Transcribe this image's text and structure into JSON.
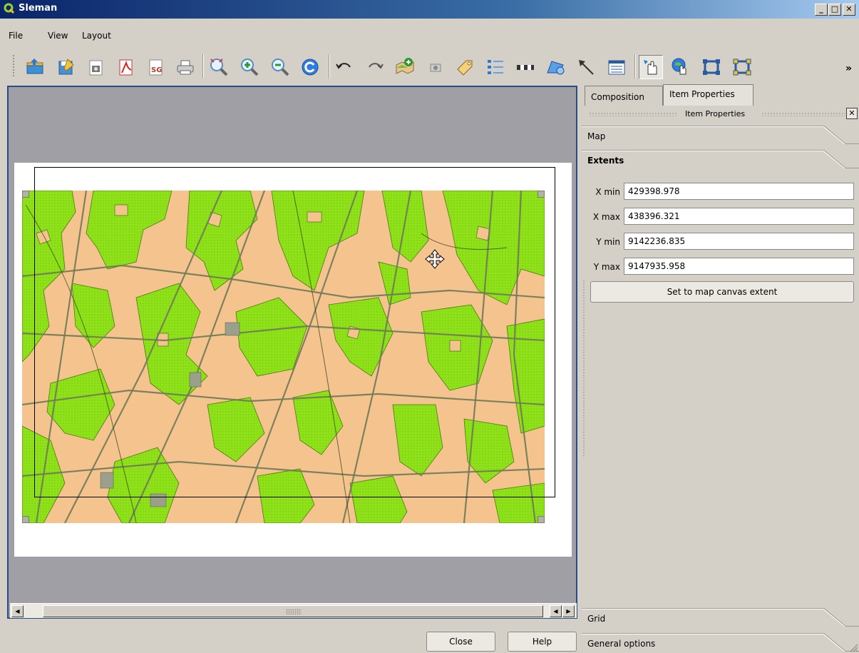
{
  "window": {
    "title": "Sleman"
  },
  "menu": {
    "items": [
      "File",
      "View",
      "Layout"
    ]
  },
  "toolbar": {
    "tools": [
      "load-from-template",
      "save-as-template",
      "export-image",
      "export-pdf",
      "export-svg",
      "print",
      "zoom-full",
      "zoom-in",
      "zoom-out",
      "refresh",
      "undo",
      "redo",
      "add-map",
      "add-image",
      "add-label",
      "add-legend",
      "add-scalebar",
      "add-shape",
      "add-arrow",
      "add-table",
      "select-move-item",
      "move-item-content",
      "group-items",
      "ungroup-items"
    ],
    "more": "»"
  },
  "panel": {
    "tabs": [
      "Composition",
      "Item Properties"
    ],
    "active_tab": "Item Properties",
    "dock_title": "Item Properties",
    "sections": {
      "map": "Map",
      "extents": "Extents",
      "grid": "Grid",
      "general": "General options"
    },
    "extents": {
      "xmin_label": "X min",
      "xmin": "429398.978",
      "xmax_label": "X max",
      "xmax": "438396.321",
      "ymin_label": "Y min",
      "ymin": "9142236.835",
      "ymax_label": "Y max",
      "ymax": "9147935.958"
    },
    "set_extent_button": "Set to map canvas extent"
  },
  "footer": {
    "close": "Close",
    "help": "Help"
  },
  "colors": {
    "land": "#f5c48e",
    "vegetation": "#8fe11a",
    "road": "#6f7a56",
    "title_bar": "#0a246a"
  }
}
